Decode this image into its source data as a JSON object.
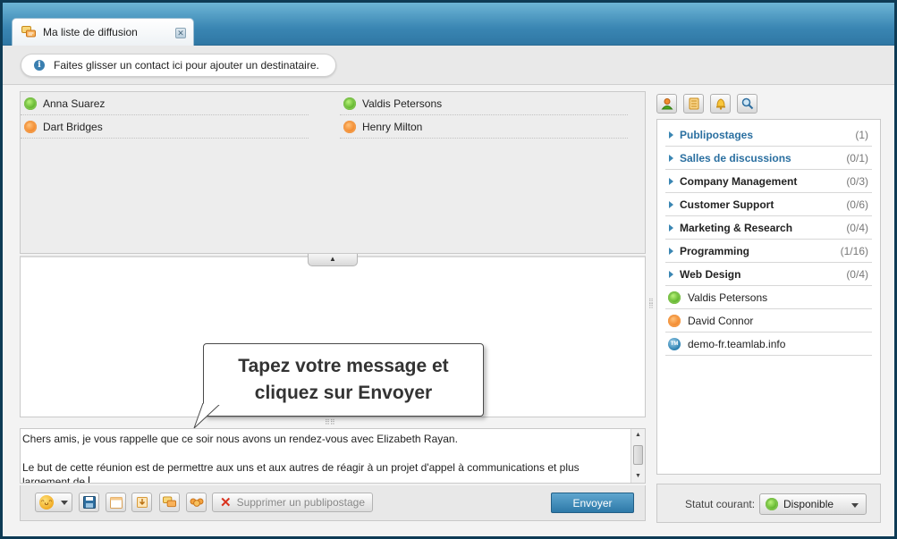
{
  "tab": {
    "title": "Ma liste de diffusion",
    "close_icon": "close-icon"
  },
  "info": {
    "text": "Faites glisser un contact ici pour ajouter un destinataire."
  },
  "recipients": {
    "left": [
      {
        "name": "Anna Suarez",
        "status": "online"
      },
      {
        "name": "Dart Bridges",
        "status": "away"
      }
    ],
    "right": [
      {
        "name": "Valdis Petersons",
        "status": "online"
      },
      {
        "name": "Henry Milton",
        "status": "away"
      }
    ]
  },
  "callout": {
    "line1": "Tapez votre message et",
    "line2": "cliquez sur Envoyer"
  },
  "message": {
    "line1": "Chers amis, je vous rappelle que ce soir nous avons un rendez-vous avec Elizabeth Rayan.",
    "line2": "Le but de cette réunion est de permettre aux uns et aux autres de réagir à un projet d'appel à communications et plus",
    "line3": "largement de "
  },
  "toolbar": {
    "delete_label": "Supprimer un publipostage",
    "send_label": "Envoyer"
  },
  "contacts": {
    "groups": [
      {
        "name": "Publipostages",
        "count": "(1)",
        "link": true
      },
      {
        "name": "Salles de discussions",
        "count": "(0/1)",
        "link": true
      },
      {
        "name": "Company Management",
        "count": "(0/3)",
        "link": false
      },
      {
        "name": "Customer Support",
        "count": "(0/6)",
        "link": false
      },
      {
        "name": "Marketing & Research",
        "count": "(0/4)",
        "link": false
      },
      {
        "name": "Programming",
        "count": "(1/16)",
        "link": false
      },
      {
        "name": "Web Design",
        "count": "(0/4)",
        "link": false
      }
    ],
    "people": [
      {
        "name": "Valdis Petersons",
        "status": "online"
      },
      {
        "name": "David Connor",
        "status": "away"
      },
      {
        "name": "demo-fr.teamlab.info",
        "status": "server"
      }
    ]
  },
  "status": {
    "label": "Statut courant:",
    "value": "Disponible"
  },
  "colors": {
    "accent": "#3a86b3",
    "online": "#4da81c",
    "away": "#f07d1e",
    "send": "#2d79a8"
  }
}
